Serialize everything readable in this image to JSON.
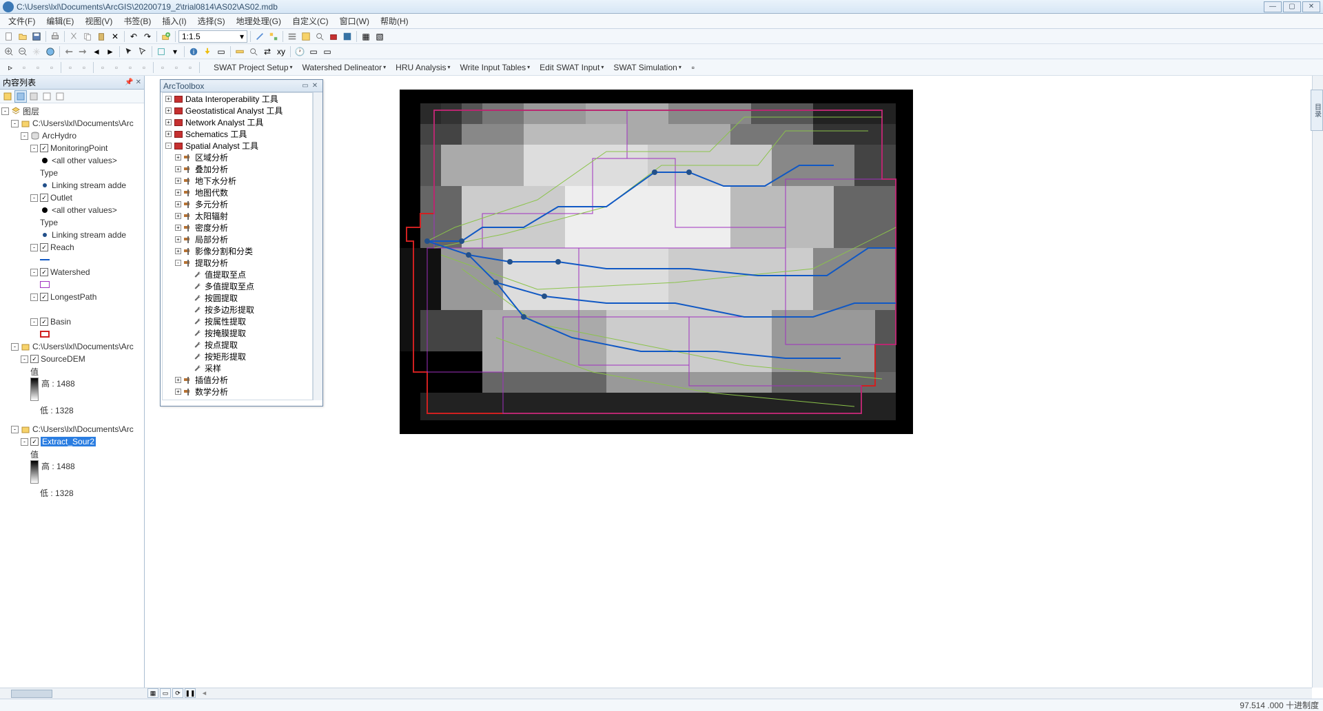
{
  "titlebar": {
    "path": "C:\\Users\\lxl\\Documents\\ArcGIS\\20200719_2\\trial0814\\AS02\\AS02.mdb"
  },
  "menu": [
    "文件(F)",
    "编辑(E)",
    "视图(V)",
    "书签(B)",
    "插入(I)",
    "选择(S)",
    "地理处理(G)",
    "自定义(C)",
    "窗口(W)",
    "帮助(H)"
  ],
  "scale": "1:1.5",
  "swat_menu": [
    "SWAT Project Setup",
    "Watershed Delineator",
    "HRU Analysis",
    "Write Input Tables",
    "Edit SWAT Input",
    "SWAT Simulation"
  ],
  "toc": {
    "title": "内容列表",
    "root": "图层",
    "group1": "C:\\Users\\lxl\\Documents\\Arc",
    "archydro": "ArcHydro",
    "monitoring": "MonitoringPoint",
    "allother": "<all other values>",
    "type": "Type",
    "linking": "Linking stream adde",
    "outlet": "Outlet",
    "reach": "Reach",
    "watershed": "Watershed",
    "longest": "LongestPath",
    "basin": "Basin",
    "group2": "C:\\Users\\lxl\\Documents\\Arc",
    "sourcedem": "SourceDEM",
    "value": "值",
    "high": "高 : 1488",
    "low": "低 : 1328",
    "group3": "C:\\Users\\lxl\\Documents\\Arc",
    "extract": "Extract_Sour2"
  },
  "toolbox": {
    "title": "ArcToolbox",
    "items": [
      {
        "lvl": 1,
        "type": "tb",
        "exp": "+",
        "label": "Data Interoperability 工具"
      },
      {
        "lvl": 1,
        "type": "tb",
        "exp": "+",
        "label": "Geostatistical Analyst 工具"
      },
      {
        "lvl": 1,
        "type": "tb",
        "exp": "+",
        "label": "Network Analyst 工具"
      },
      {
        "lvl": 1,
        "type": "tb",
        "exp": "+",
        "label": "Schematics 工具"
      },
      {
        "lvl": 1,
        "type": "tb",
        "exp": "-",
        "label": "Spatial Analyst 工具"
      },
      {
        "lvl": 2,
        "type": "ts",
        "exp": "+",
        "label": "区域分析"
      },
      {
        "lvl": 2,
        "type": "ts",
        "exp": "+",
        "label": "叠加分析"
      },
      {
        "lvl": 2,
        "type": "ts",
        "exp": "+",
        "label": "地下水分析"
      },
      {
        "lvl": 2,
        "type": "ts",
        "exp": "+",
        "label": "地图代数"
      },
      {
        "lvl": 2,
        "type": "ts",
        "exp": "+",
        "label": "多元分析"
      },
      {
        "lvl": 2,
        "type": "ts",
        "exp": "+",
        "label": "太阳辐射"
      },
      {
        "lvl": 2,
        "type": "ts",
        "exp": "+",
        "label": "密度分析"
      },
      {
        "lvl": 2,
        "type": "ts",
        "exp": "+",
        "label": "局部分析"
      },
      {
        "lvl": 2,
        "type": "ts",
        "exp": "+",
        "label": "影像分割和分类"
      },
      {
        "lvl": 2,
        "type": "ts",
        "exp": "-",
        "label": "提取分析"
      },
      {
        "lvl": 3,
        "type": "tool",
        "label": "值提取至点"
      },
      {
        "lvl": 3,
        "type": "tool",
        "label": "多值提取至点"
      },
      {
        "lvl": 3,
        "type": "tool",
        "label": "按圆提取"
      },
      {
        "lvl": 3,
        "type": "tool",
        "label": "按多边形提取"
      },
      {
        "lvl": 3,
        "type": "tool",
        "label": "按属性提取"
      },
      {
        "lvl": 3,
        "type": "tool",
        "label": "按掩膜提取"
      },
      {
        "lvl": 3,
        "type": "tool",
        "label": "按点提取"
      },
      {
        "lvl": 3,
        "type": "tool",
        "label": "按矩形提取"
      },
      {
        "lvl": 3,
        "type": "tool",
        "label": "采样"
      },
      {
        "lvl": 2,
        "type": "ts",
        "exp": "+",
        "label": "插值分析"
      },
      {
        "lvl": 2,
        "type": "ts",
        "exp": "+",
        "label": "数学分析"
      }
    ]
  },
  "status": {
    "coords": "97.514 .000 十进制度"
  },
  "side_tab": "目录"
}
